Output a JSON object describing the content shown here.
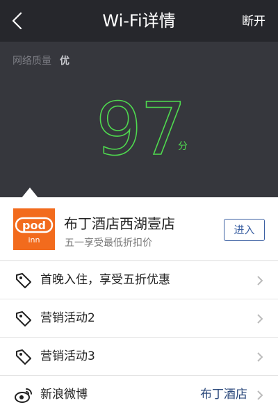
{
  "header": {
    "title": "Wi-Fi详情",
    "disconnect_label": "断开"
  },
  "quality": {
    "label": "网络质量",
    "value": "优",
    "score": "97",
    "unit": "分"
  },
  "hotel": {
    "logo_text_top": "pod",
    "logo_text_bottom": "inn",
    "name": "布丁酒店西湖壹店",
    "promo": "五一享受最低折扣价",
    "enter_label": "进入"
  },
  "list": [
    {
      "icon": "tag-icon",
      "label": "首晚入住，享受五折优惠",
      "value": ""
    },
    {
      "icon": "tag-icon",
      "label": "营销活动2",
      "value": ""
    },
    {
      "icon": "tag-icon",
      "label": "营销活动3",
      "value": ""
    },
    {
      "icon": "weibo-icon",
      "label": "新浪微博",
      "value": "布丁酒店"
    }
  ],
  "colors": {
    "header_bg": "#26272c",
    "panel_bg": "#36373d",
    "score_green": "#4fd94f",
    "brand_orange": "#f26b1d",
    "link_blue": "#3a5fa2"
  }
}
